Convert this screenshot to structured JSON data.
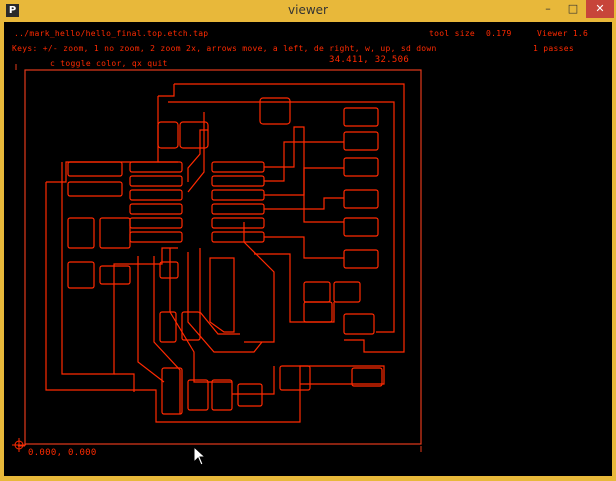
{
  "window": {
    "app_icon": "P",
    "title": "viewer",
    "minimize_icon": "–",
    "maximize_icon": "□",
    "close_icon": "✕"
  },
  "hud": {
    "file_path": "../mark_hello/hello_final.top.etch.tap",
    "tool_size_label": "tool size",
    "tool_size_value": "0.179",
    "version": "Viewer 1.6",
    "keys_line1": "Keys: +/- zoom, 1 no zoom, 2 zoom 2x, arrows move, a left, de right, w, up, sd down",
    "passes": "1 passes",
    "keys_line2": "c toggle color, qx quit",
    "cursor_coords": "34.411, 32.506",
    "origin_coords": "0.000, 0.000"
  },
  "colors": {
    "trace": "#ff2a00",
    "border": "#e23a1a",
    "background": "#000000",
    "window_frame": "#e8b83a"
  }
}
